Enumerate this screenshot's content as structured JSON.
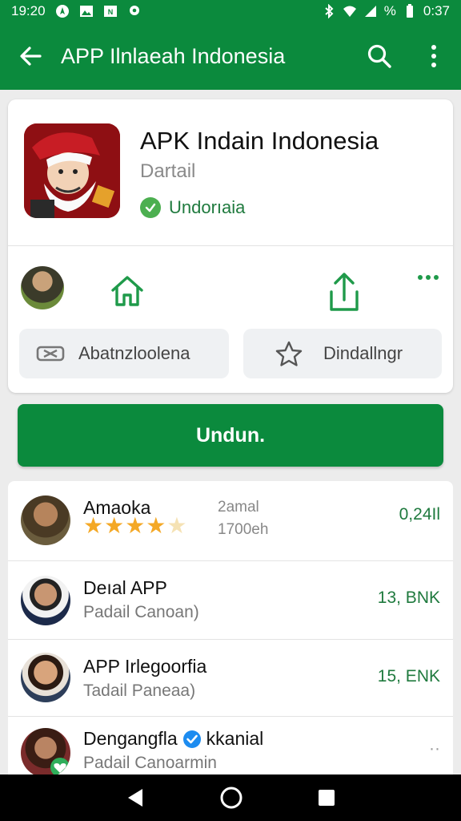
{
  "status": {
    "time": "19:20",
    "right_time": "0:37",
    "battery": "%"
  },
  "appbar": {
    "title": "APP Ilnlaeah Indonesia"
  },
  "app": {
    "name": "APK Indain Indonesia",
    "subtitle": "Dartail",
    "verified_label": "Undorıaia"
  },
  "chips": {
    "left_label": "Abatnzloolena",
    "right_label": "Dindallngr"
  },
  "install_label": "Undun.",
  "list": [
    {
      "name": "Amaoka",
      "meta1": "2amal",
      "meta2": "1700eh",
      "value": "0,24Il",
      "rating": 4
    },
    {
      "name": "Deıal APP",
      "sub": "Padail Canoan)",
      "value": "13, BNK"
    },
    {
      "name": "APP Irlegoorfia",
      "sub": "Tadail Paneaa)",
      "value": "15, ENK"
    },
    {
      "name": "Dengangfla",
      "name_suffix": "kkanial",
      "sub": "Padail Canoarmin",
      "value": "··"
    }
  ],
  "colors": {
    "primary": "#0b8a3d",
    "accent_green": "#1f7a3e",
    "star": "#f4a825"
  },
  "icons": [
    "back-arrow-icon",
    "search-icon",
    "more-vert-icon",
    "home-icon",
    "share-icon",
    "more-horiz-icon",
    "sync-icon",
    "star-icon",
    "verified-icon",
    "nav-back-icon",
    "nav-home-icon",
    "nav-recents-icon"
  ]
}
